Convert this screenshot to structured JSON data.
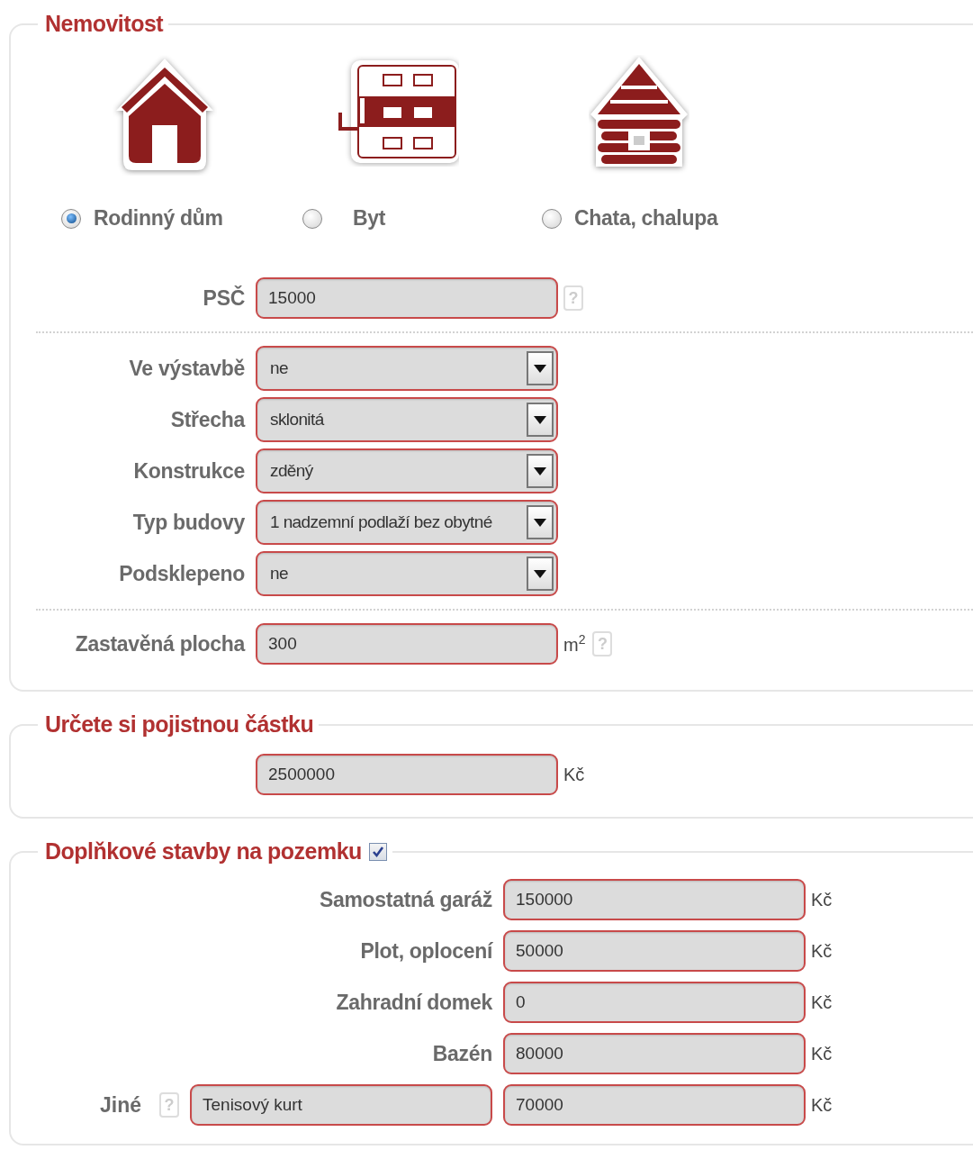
{
  "property_section": {
    "title": "Nemovitost",
    "types": [
      {
        "kind": "house",
        "label": "Rodinný dům",
        "selected": true
      },
      {
        "kind": "apartment",
        "label": "Byt",
        "selected": false
      },
      {
        "kind": "cabin",
        "label": "Chata, chalupa",
        "selected": false
      }
    ],
    "postcode": {
      "label": "PSČ",
      "value": "15000",
      "help": "?"
    },
    "selects": [
      {
        "label": "Ve výstavbě",
        "value": "ne"
      },
      {
        "label": "Střecha",
        "value": "sklonitá"
      },
      {
        "label": "Konstrukce",
        "value": "zděný"
      },
      {
        "label": "Typ budovy",
        "value": "1 nadzemní podlaží bez obytné"
      },
      {
        "label": "Podsklepeno",
        "value": "ne"
      }
    ],
    "built_area": {
      "label": "Zastavěná plocha",
      "value": "300",
      "unit": "m$^{2}$",
      "help": "?"
    }
  },
  "sum_section": {
    "title": "Určete si pojistnou částku",
    "value": "2500000",
    "unit": "Kč"
  },
  "extra_section": {
    "title": "Doplňkové stavby na pozemku",
    "checked": true,
    "rows": [
      {
        "kind": "fixed",
        "label": "Samostatná garáž",
        "value": "150000",
        "unit": "Kč"
      },
      {
        "kind": "fixed",
        "label": "Plot, oplocení",
        "value": "50000",
        "unit": "Kč"
      },
      {
        "kind": "fixed",
        "label": "Zahradní domek",
        "value": "0",
        "unit": "Kč"
      },
      {
        "kind": "fixed",
        "label": "Bazén",
        "value": "80000",
        "unit": "Kč"
      },
      {
        "kind": "custom",
        "label": "Jiné",
        "help": "?",
        "name_value": "Tenisový kurt",
        "value": "70000",
        "unit": "Kč"
      }
    ]
  }
}
